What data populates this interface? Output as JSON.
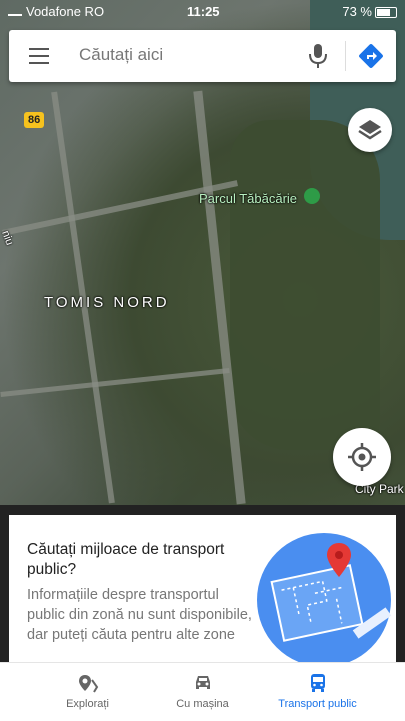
{
  "status_bar": {
    "carrier": "Vodafone RO",
    "time": "11:25",
    "battery": "73 %"
  },
  "search": {
    "placeholder": "Căutați aici"
  },
  "map": {
    "labels": {
      "road_shield": "86",
      "park": "Parcul Tăbăcărie",
      "district": "TOMIS NORD",
      "street_fragment": "niu",
      "city_park": "City Park"
    }
  },
  "card": {
    "title": "Căutați mijloace de transport public?",
    "description": "Informațiile despre transportul public din zonă nu sunt disponibile, dar puteți căuta pentru alte zone"
  },
  "tabs": [
    {
      "label": "Explorați",
      "icon": "explore-pin-icon",
      "active": false
    },
    {
      "label": "Cu mașina",
      "icon": "car-icon",
      "active": false
    },
    {
      "label": "Transport public",
      "icon": "bus-icon",
      "active": true
    }
  ],
  "colors": {
    "accent": "#1a73e8",
    "park_pin": "#2e9b47",
    "shield": "#f6c21e"
  }
}
